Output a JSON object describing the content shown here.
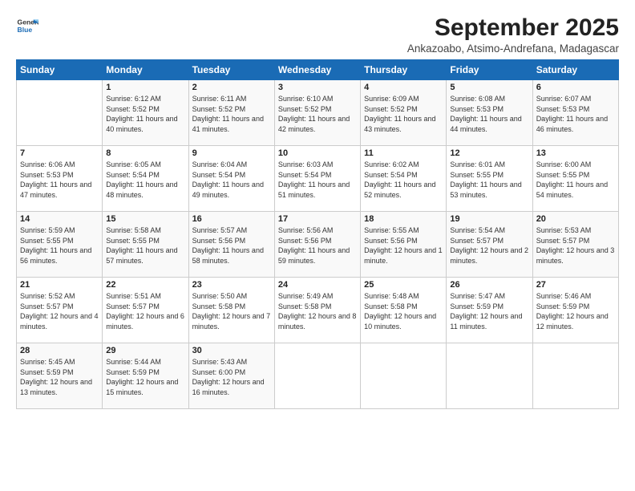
{
  "logo": {
    "line1": "General",
    "line2": "Blue"
  },
  "title": "September 2025",
  "subtitle": "Ankazoabo, Atsimo-Andrefana, Madagascar",
  "header_days": [
    "Sunday",
    "Monday",
    "Tuesday",
    "Wednesday",
    "Thursday",
    "Friday",
    "Saturday"
  ],
  "weeks": [
    [
      {
        "day": "",
        "sunrise": "",
        "sunset": "",
        "daylight": ""
      },
      {
        "day": "1",
        "sunrise": "6:12 AM",
        "sunset": "5:52 PM",
        "daylight": "11 hours and 40 minutes."
      },
      {
        "day": "2",
        "sunrise": "6:11 AM",
        "sunset": "5:52 PM",
        "daylight": "11 hours and 41 minutes."
      },
      {
        "day": "3",
        "sunrise": "6:10 AM",
        "sunset": "5:52 PM",
        "daylight": "11 hours and 42 minutes."
      },
      {
        "day": "4",
        "sunrise": "6:09 AM",
        "sunset": "5:52 PM",
        "daylight": "11 hours and 43 minutes."
      },
      {
        "day": "5",
        "sunrise": "6:08 AM",
        "sunset": "5:53 PM",
        "daylight": "11 hours and 44 minutes."
      },
      {
        "day": "6",
        "sunrise": "6:07 AM",
        "sunset": "5:53 PM",
        "daylight": "11 hours and 46 minutes."
      }
    ],
    [
      {
        "day": "7",
        "sunrise": "6:06 AM",
        "sunset": "5:53 PM",
        "daylight": "11 hours and 47 minutes."
      },
      {
        "day": "8",
        "sunrise": "6:05 AM",
        "sunset": "5:54 PM",
        "daylight": "11 hours and 48 minutes."
      },
      {
        "day": "9",
        "sunrise": "6:04 AM",
        "sunset": "5:54 PM",
        "daylight": "11 hours and 49 minutes."
      },
      {
        "day": "10",
        "sunrise": "6:03 AM",
        "sunset": "5:54 PM",
        "daylight": "11 hours and 51 minutes."
      },
      {
        "day": "11",
        "sunrise": "6:02 AM",
        "sunset": "5:54 PM",
        "daylight": "11 hours and 52 minutes."
      },
      {
        "day": "12",
        "sunrise": "6:01 AM",
        "sunset": "5:55 PM",
        "daylight": "11 hours and 53 minutes."
      },
      {
        "day": "13",
        "sunrise": "6:00 AM",
        "sunset": "5:55 PM",
        "daylight": "11 hours and 54 minutes."
      }
    ],
    [
      {
        "day": "14",
        "sunrise": "5:59 AM",
        "sunset": "5:55 PM",
        "daylight": "11 hours and 56 minutes."
      },
      {
        "day": "15",
        "sunrise": "5:58 AM",
        "sunset": "5:55 PM",
        "daylight": "11 hours and 57 minutes."
      },
      {
        "day": "16",
        "sunrise": "5:57 AM",
        "sunset": "5:56 PM",
        "daylight": "11 hours and 58 minutes."
      },
      {
        "day": "17",
        "sunrise": "5:56 AM",
        "sunset": "5:56 PM",
        "daylight": "11 hours and 59 minutes."
      },
      {
        "day": "18",
        "sunrise": "5:55 AM",
        "sunset": "5:56 PM",
        "daylight": "12 hours and 1 minute."
      },
      {
        "day": "19",
        "sunrise": "5:54 AM",
        "sunset": "5:57 PM",
        "daylight": "12 hours and 2 minutes."
      },
      {
        "day": "20",
        "sunrise": "5:53 AM",
        "sunset": "5:57 PM",
        "daylight": "12 hours and 3 minutes."
      }
    ],
    [
      {
        "day": "21",
        "sunrise": "5:52 AM",
        "sunset": "5:57 PM",
        "daylight": "12 hours and 4 minutes."
      },
      {
        "day": "22",
        "sunrise": "5:51 AM",
        "sunset": "5:57 PM",
        "daylight": "12 hours and 6 minutes."
      },
      {
        "day": "23",
        "sunrise": "5:50 AM",
        "sunset": "5:58 PM",
        "daylight": "12 hours and 7 minutes."
      },
      {
        "day": "24",
        "sunrise": "5:49 AM",
        "sunset": "5:58 PM",
        "daylight": "12 hours and 8 minutes."
      },
      {
        "day": "25",
        "sunrise": "5:48 AM",
        "sunset": "5:58 PM",
        "daylight": "12 hours and 10 minutes."
      },
      {
        "day": "26",
        "sunrise": "5:47 AM",
        "sunset": "5:59 PM",
        "daylight": "12 hours and 11 minutes."
      },
      {
        "day": "27",
        "sunrise": "5:46 AM",
        "sunset": "5:59 PM",
        "daylight": "12 hours and 12 minutes."
      }
    ],
    [
      {
        "day": "28",
        "sunrise": "5:45 AM",
        "sunset": "5:59 PM",
        "daylight": "12 hours and 13 minutes."
      },
      {
        "day": "29",
        "sunrise": "5:44 AM",
        "sunset": "5:59 PM",
        "daylight": "12 hours and 15 minutes."
      },
      {
        "day": "30",
        "sunrise": "5:43 AM",
        "sunset": "6:00 PM",
        "daylight": "12 hours and 16 minutes."
      },
      {
        "day": "",
        "sunrise": "",
        "sunset": "",
        "daylight": ""
      },
      {
        "day": "",
        "sunrise": "",
        "sunset": "",
        "daylight": ""
      },
      {
        "day": "",
        "sunrise": "",
        "sunset": "",
        "daylight": ""
      },
      {
        "day": "",
        "sunrise": "",
        "sunset": "",
        "daylight": ""
      }
    ]
  ]
}
